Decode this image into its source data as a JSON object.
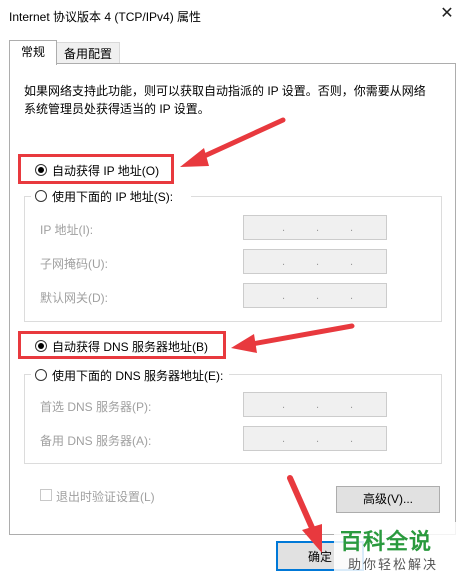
{
  "window": {
    "title": "Internet 协议版本 4 (TCP/IPv4) 属性",
    "close_glyph": "✕"
  },
  "tabs": [
    {
      "label": "常规"
    },
    {
      "label": "备用配置"
    }
  ],
  "description": "如果网络支持此功能，则可以获取自动指派的 IP 设置。否则，你需要从网络系统管理员处获得适当的 IP 设置。",
  "ip": {
    "auto_label": "自动获得 IP 地址(O)",
    "auto_selected": true,
    "manual_label": "使用下面的 IP 地址(S):",
    "fields": [
      {
        "label": "IP 地址(I):"
      },
      {
        "label": "子网掩码(U):"
      },
      {
        "label": "默认网关(D):"
      }
    ]
  },
  "dns": {
    "auto_label": "自动获得 DNS 服务器地址(B)",
    "auto_selected": true,
    "manual_label": "使用下面的 DNS 服务器地址(E):",
    "fields": [
      {
        "label": "首选 DNS 服务器(P):"
      },
      {
        "label": "备用 DNS 服务器(A):"
      }
    ]
  },
  "ip_dot": ".",
  "validate_label": "退出时验证设置(L)",
  "advanced_label": "高级(V)...",
  "ok_label": "确定",
  "watermark": {
    "title": "百科全说",
    "subtitle": "助你轻松解决"
  },
  "colors": {
    "highlight": "#e8393e",
    "watermark_green": "#2a9a3e"
  }
}
